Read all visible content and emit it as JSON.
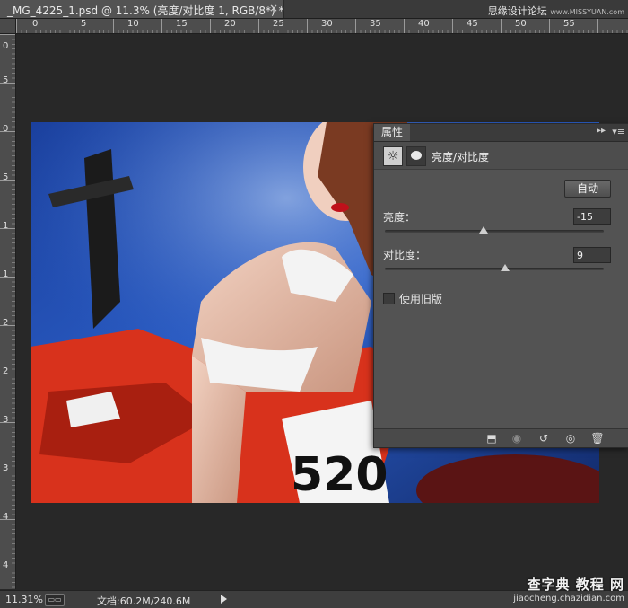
{
  "tab": {
    "title": "_MG_4225_1.psd @ 11.3% (亮度/对比度 1, RGB/8*) *",
    "close": "×"
  },
  "watermark_top": {
    "cn": "思缘设计论坛",
    "url": "www.MISSYUAN.com"
  },
  "ruler": {
    "h_ticks": [
      "0",
      "5",
      "10",
      "15",
      "20",
      "25",
      "30",
      "35",
      "40",
      "45",
      "50",
      "55"
    ],
    "v_ticks": [
      "0",
      "5",
      "0",
      "5",
      "1",
      "1",
      "2",
      "2",
      "3",
      "3",
      "4",
      "4"
    ]
  },
  "panel": {
    "tab_label": "属性",
    "collapse_icon": "▸▸",
    "menu_icon": "▾≡",
    "adjustment_title": "亮度/对比度",
    "auto_label": "自动",
    "brightness": {
      "label": "亮度：",
      "value": "-15",
      "slider_fraction": 0.45
    },
    "contrast": {
      "label": "对比度：",
      "value": "9",
      "slider_fraction": 0.55
    },
    "legacy_label": "使用旧版",
    "legacy_checked": false,
    "footer_icons": [
      "clip-to-layer-icon",
      "view-previous-state-icon",
      "reset-icon",
      "visibility-eye-icon",
      "delete-trash-icon"
    ]
  },
  "status": {
    "zoom": "11.31%",
    "doc_info": "文档:60.2M/240.6M"
  },
  "watermark_bottom": {
    "cn": "查字典 教程 网",
    "url": "jiaocheng.chazidian.com"
  },
  "colors": {
    "panel_bg": "#535353",
    "workspace_bg": "#282828",
    "photo_blue": "#1f4fb0",
    "photo_red": "#d8321c"
  }
}
